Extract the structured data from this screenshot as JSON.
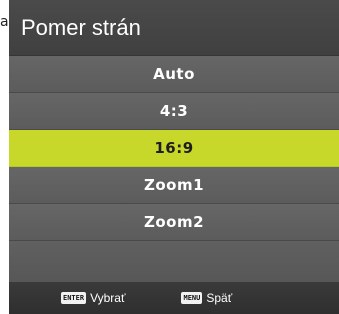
{
  "edge_text": "a",
  "menu": {
    "title": "Pomer strán",
    "items": [
      {
        "label": "Auto",
        "selected": false
      },
      {
        "label": "4:3",
        "selected": false
      },
      {
        "label": "16:9",
        "selected": true
      },
      {
        "label": "Zoom1",
        "selected": false
      },
      {
        "label": "Zoom2",
        "selected": false
      }
    ]
  },
  "footer": {
    "enter_key": "ENTER",
    "enter_label": "Vybrať",
    "menu_key": "MENU",
    "menu_label": "Späť"
  },
  "colors": {
    "selected_highlight": "#c7d82b",
    "panel": "#5a5a5a",
    "header": "#444444",
    "footer": "#333333"
  }
}
